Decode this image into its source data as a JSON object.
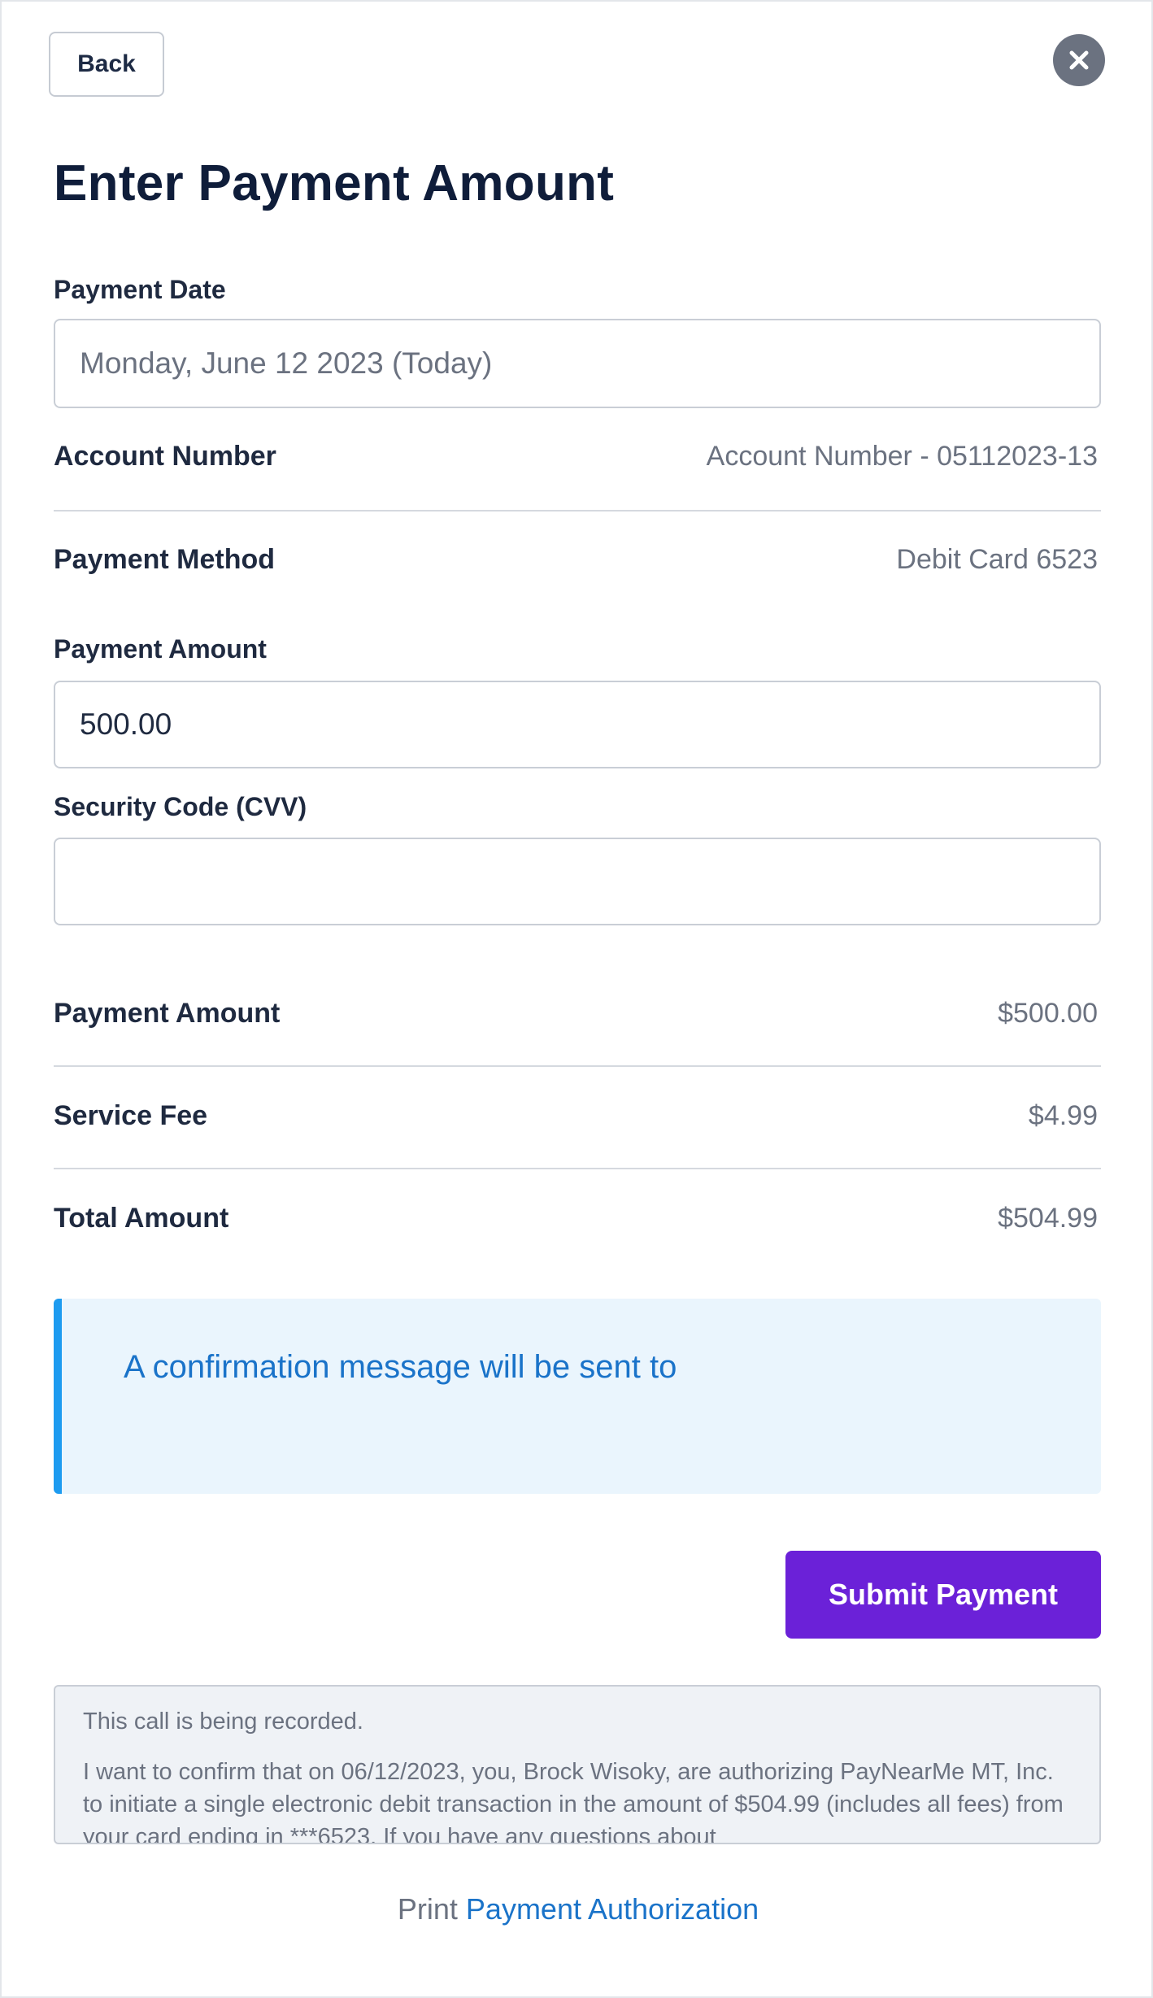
{
  "header": {
    "back_label": "Back",
    "close_icon": "close-icon",
    "title": "Enter Payment Amount"
  },
  "form": {
    "payment_date": {
      "label": "Payment Date",
      "value": "Monday, June 12 2023 (Today)"
    },
    "account_number": {
      "label": "Account Number",
      "value": "Account Number - 05112023-13"
    },
    "payment_method": {
      "label": "Payment Method",
      "value": "Debit Card 6523"
    },
    "payment_amount": {
      "label": "Payment Amount",
      "value": "500.00"
    },
    "cvv": {
      "label": "Security Code (CVV)",
      "value": ""
    }
  },
  "summary": [
    {
      "label": "Payment Amount",
      "value": "$500.00"
    },
    {
      "label": "Service Fee",
      "value": "$4.99"
    },
    {
      "label": "Total Amount",
      "value": "$504.99"
    }
  ],
  "notice": {
    "text": "A confirmation message will be sent to"
  },
  "actions": {
    "submit_label": "Submit Payment"
  },
  "script": {
    "line1": "This call is being recorded.",
    "body": "I want to confirm that on 06/12/2023, you, Brock Wisoky, are authorizing PayNearMe MT, Inc. to initiate a single electronic debit transaction in the amount of $504.99 (includes all fees) from your card ending in ***6523. If you have any questions about"
  },
  "footer": {
    "print_prefix": "Print",
    "print_link": "Payment Authorization"
  },
  "colors": {
    "accent": "#6b21d8",
    "info": "#1a73c9",
    "info_bg": "#eaf5fd",
    "info_border": "#1d9bf0"
  }
}
